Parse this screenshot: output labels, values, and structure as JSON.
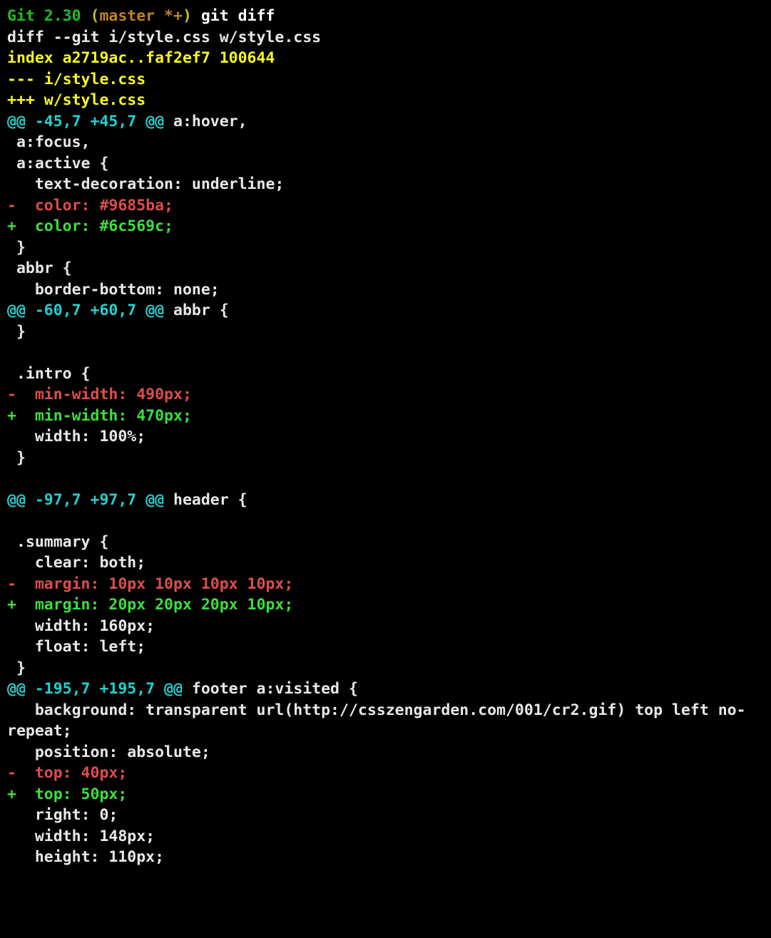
{
  "prompt": {
    "label": "Git 2.30",
    "branch_open": " (",
    "branch": "master *+",
    "branch_close": ") ",
    "command": "git diff"
  },
  "lines": [
    {
      "cls": "c-white",
      "text": "diff --git i/style.css w/style.css"
    },
    {
      "cls": "c-yellow",
      "text": "index a2719ac..faf2ef7 100644"
    },
    {
      "cls": "c-yellow",
      "text": "--- i/style.css"
    },
    {
      "cls": "c-yellow",
      "text": "+++ w/style.css"
    },
    {
      "hunk": true,
      "cyan": "@@ -45,7 +45,7 @@",
      "tail": " a:hover,"
    },
    {
      "cls": "c-white",
      "text": " a:focus,"
    },
    {
      "cls": "c-white",
      "text": " a:active {"
    },
    {
      "cls": "c-white",
      "text": "   text-decoration: underline;"
    },
    {
      "cls": "c-red",
      "text": "-  color: #9685ba;"
    },
    {
      "cls": "c-bgreen",
      "text": "+  color: #6c569c;"
    },
    {
      "cls": "c-white",
      "text": " }"
    },
    {
      "cls": "c-white",
      "text": " abbr {"
    },
    {
      "cls": "c-white",
      "text": "   border-bottom: none;"
    },
    {
      "hunk": true,
      "cyan": "@@ -60,7 +60,7 @@",
      "tail": " abbr {"
    },
    {
      "cls": "c-white",
      "text": " }"
    },
    {
      "cls": "c-white",
      "text": " "
    },
    {
      "cls": "c-white",
      "text": " .intro {"
    },
    {
      "cls": "c-red",
      "text": "-  min-width: 490px;"
    },
    {
      "cls": "c-bgreen",
      "text": "+  min-width: 470px;"
    },
    {
      "cls": "c-white",
      "text": "   width: 100%;"
    },
    {
      "cls": "c-white",
      "text": " }"
    },
    {
      "cls": "c-white",
      "text": " "
    },
    {
      "hunk": true,
      "cyan": "@@ -97,7 +97,7 @@",
      "tail": " header {"
    },
    {
      "cls": "c-white",
      "text": " "
    },
    {
      "cls": "c-white",
      "text": " .summary {"
    },
    {
      "cls": "c-white",
      "text": "   clear: both;"
    },
    {
      "cls": "c-red",
      "text": "-  margin: 10px 10px 10px 10px;"
    },
    {
      "cls": "c-bgreen",
      "text": "+  margin: 20px 20px 20px 10px;"
    },
    {
      "cls": "c-white",
      "text": "   width: 160px;"
    },
    {
      "cls": "c-white",
      "text": "   float: left;"
    },
    {
      "cls": "c-white",
      "text": " }"
    },
    {
      "hunk": true,
      "cyan": "@@ -195,7 +195,7 @@",
      "tail": " footer a:visited {"
    },
    {
      "cls": "c-white",
      "text": "   background: transparent url(http://csszengarden.com/001/cr2.gif) top left no-repeat;"
    },
    {
      "cls": "c-white",
      "text": "   position: absolute;"
    },
    {
      "cls": "c-red",
      "text": "-  top: 40px;"
    },
    {
      "cls": "c-bgreen",
      "text": "+  top: 50px;"
    },
    {
      "cls": "c-white",
      "text": "   right: 0;"
    },
    {
      "cls": "c-white",
      "text": "   width: 148px;"
    },
    {
      "cls": "c-white",
      "text": "   height: 110px;"
    }
  ]
}
